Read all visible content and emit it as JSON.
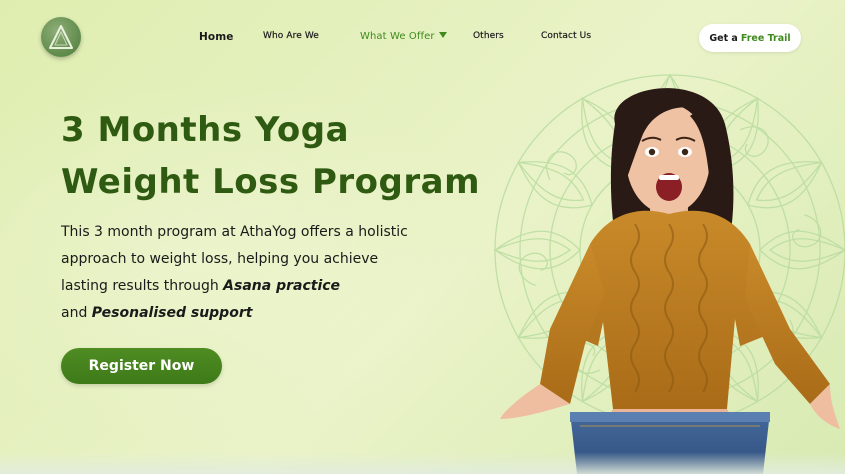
{
  "header": {
    "logo_icon": "triangle-logo-icon",
    "nav": {
      "home": "Home",
      "who": "Who Are We",
      "offer": "What We Offer",
      "others": "Others",
      "contact": "Contact Us"
    },
    "cta": {
      "prefix": "Get a",
      "highlight": "Free Trail"
    }
  },
  "hero": {
    "title_line1": "3 Months Yoga",
    "title_line2": "Weight Loss Program",
    "desc_line1": "This 3 month program at AthaYog offers a holistic",
    "desc_line2": "approach to weight loss, helping you achieve",
    "desc_line3_prefix": "lasting results through",
    "desc_line3_bold": "Asana practice",
    "desc_line4_prefix": "and",
    "desc_line4_bold": "Pesonalised support",
    "register_label": "Register Now"
  },
  "colors": {
    "accent": "#3f8a1d",
    "title": "#2f5a12",
    "button": "#4a8620",
    "background": "#e2efbb"
  }
}
